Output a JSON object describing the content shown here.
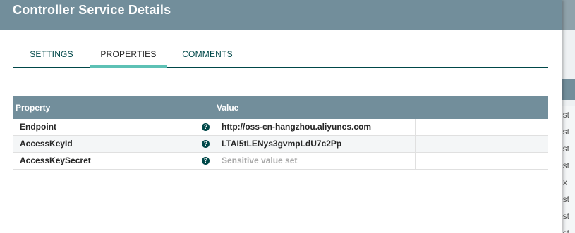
{
  "dialog": {
    "title": "Controller Service Details"
  },
  "tabs": [
    {
      "label": "SETTINGS",
      "active": false
    },
    {
      "label": "PROPERTIES",
      "active": true
    },
    {
      "label": "COMMENTS",
      "active": false
    }
  ],
  "table": {
    "headers": {
      "property": "Property",
      "value": "Value"
    },
    "rows": [
      {
        "property": "Endpoint",
        "value": "http://oss-cn-hangzhou.aliyuncs.com",
        "sensitive": false
      },
      {
        "property": "AccessKeyId",
        "value": "LTAI5tLENys3gvmpLdU7c2Pp",
        "sensitive": false
      },
      {
        "property": "AccessKeySecret",
        "value": "Sensitive value set",
        "sensitive": true
      }
    ],
    "help_glyph": "?"
  },
  "background": {
    "cells": [
      "est",
      "est",
      "est",
      "est",
      "x",
      "est",
      "est",
      "est"
    ]
  },
  "colors": {
    "header_bg": "#728e9b",
    "tab_underline": "#5dc1b5",
    "help_icon": "#004849"
  }
}
